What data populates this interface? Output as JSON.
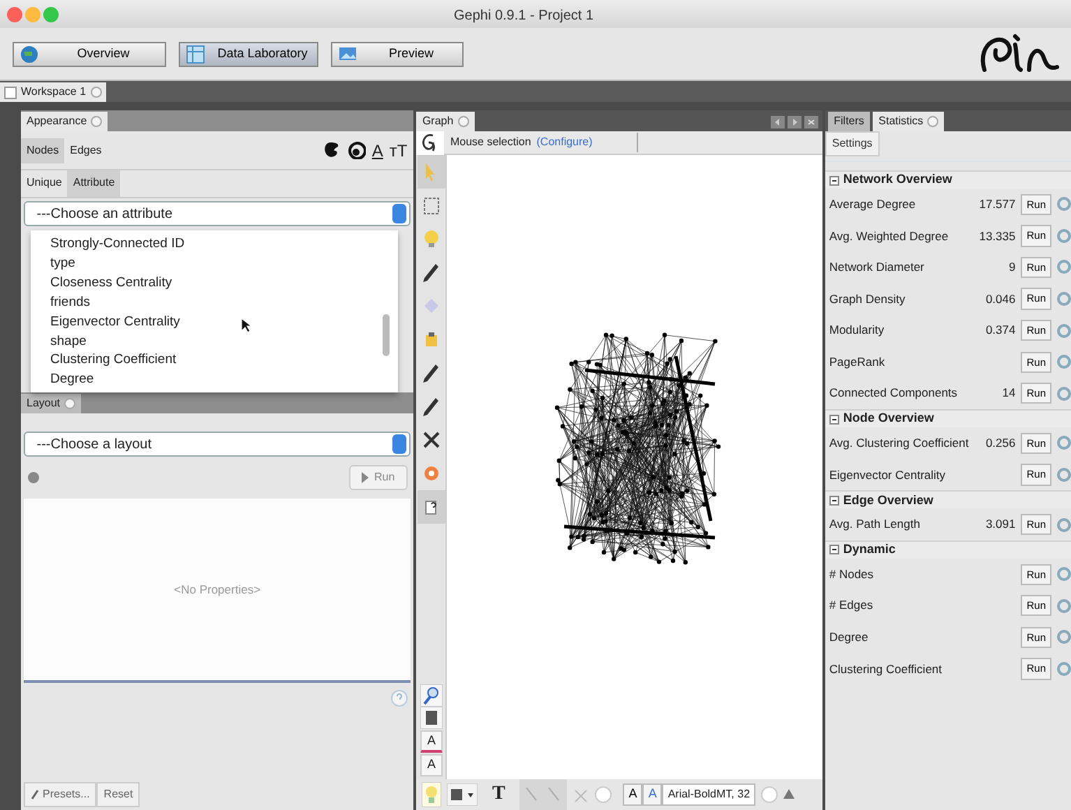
{
  "window": {
    "title": "Gephi 0.9.1 - Project 1"
  },
  "toolbar": {
    "buttons": [
      {
        "label": "Overview",
        "kind": "globe",
        "selected": false
      },
      {
        "label": "Data Laboratory",
        "kind": "table",
        "selected": true
      },
      {
        "label": "Preview",
        "kind": "preview",
        "selected": false
      }
    ]
  },
  "workspace_tabs": [
    {
      "label": "Workspace 1",
      "selected": true
    }
  ],
  "appearance": {
    "title": "Appearance",
    "element_tabs": [
      {
        "label": "Nodes",
        "selected": true
      },
      {
        "label": "Edges",
        "selected": false
      }
    ],
    "transforms": [
      {
        "kind": "color"
      },
      {
        "kind": "size"
      },
      {
        "kind": "label_color",
        "glyph": "A"
      },
      {
        "kind": "label_size",
        "glyph": "тT"
      }
    ],
    "mode_tabs": [
      {
        "label": "Unique",
        "selected": false
      },
      {
        "label": "Attribute",
        "selected": true
      }
    ],
    "attribute_select": {
      "value": "---Choose an attribute",
      "expanded": true,
      "options": [
        "Strongly-Connected ID",
        "type",
        "Closeness Centrality",
        "friends",
        "Eigenvector Centrality",
        "shape",
        "Clustering Coefficient",
        "Degree"
      ]
    }
  },
  "layout": {
    "title": "Layout",
    "select": "---Choose a layout",
    "run": "Run",
    "properties": "<No Properties>",
    "presets": "Presets...",
    "reset": "Reset"
  },
  "graph": {
    "title": "Graph",
    "mode": "Mouse selection",
    "configure": "(Configure)",
    "tools": [
      {
        "kind": "pointer",
        "selected": true
      },
      {
        "kind": "rect",
        "selected": false
      },
      {
        "kind": "bulb",
        "selected": false
      },
      {
        "kind": "pencil",
        "selected": false
      },
      {
        "kind": "diamond",
        "selected": false
      },
      {
        "kind": "paint",
        "selected": false
      },
      {
        "kind": "pencil",
        "selected": false
      },
      {
        "kind": "pencil",
        "selected": false
      },
      {
        "kind": "cross",
        "selected": false
      },
      {
        "kind": "target",
        "selected": false
      },
      {
        "kind": "help",
        "selected": true
      }
    ],
    "lower_tools": [
      {
        "kind": "zoom"
      },
      {
        "kind": "square"
      },
      {
        "kind": "label",
        "glyph": "A"
      },
      {
        "kind": "label",
        "glyph": "A"
      }
    ],
    "bottom": {
      "text_glyph": "T",
      "font_glyphs": [
        "A",
        "A"
      ],
      "font": "Arial-BoldMT, 32"
    }
  },
  "side_panel": {
    "tabs": [
      {
        "label": "Filters",
        "selected": false
      },
      {
        "label": "Statistics",
        "selected": true
      }
    ],
    "settings": "Settings",
    "sections": [
      {
        "title": "Network Overview",
        "expanded": true,
        "rows": [
          {
            "name": "Average Degree",
            "value": "17.577",
            "button": "Run"
          },
          {
            "name": "Avg. Weighted Degree",
            "value": "13.335",
            "button": "Run"
          },
          {
            "name": "Network Diameter",
            "value": "9",
            "button": "Run"
          },
          {
            "name": "Graph Density",
            "value": "0.046",
            "button": "Run"
          },
          {
            "name": "Modularity",
            "value": "0.374",
            "button": "Run"
          },
          {
            "name": "PageRank",
            "button": "Run"
          },
          {
            "name": "Connected Components",
            "value": "14",
            "button": "Run"
          }
        ]
      },
      {
        "title": "Node Overview",
        "expanded": true,
        "rows": [
          {
            "name": "Avg. Clustering Coefficient",
            "value": "0.256",
            "button": "Run"
          },
          {
            "name": "Eigenvector Centrality",
            "button": "Run"
          }
        ]
      },
      {
        "title": "Edge Overview",
        "expanded": true,
        "rows": [
          {
            "name": "Avg. Path Length",
            "value": "3.091",
            "button": "Run"
          }
        ]
      },
      {
        "title": "Dynamic",
        "expanded": true,
        "rows": [
          {
            "name": "# Nodes",
            "button": "Run"
          },
          {
            "name": "# Edges",
            "button": "Run"
          },
          {
            "name": "Degree",
            "button": "Run"
          },
          {
            "name": "Clustering Coefficient",
            "button": "Run"
          }
        ]
      }
    ]
  }
}
